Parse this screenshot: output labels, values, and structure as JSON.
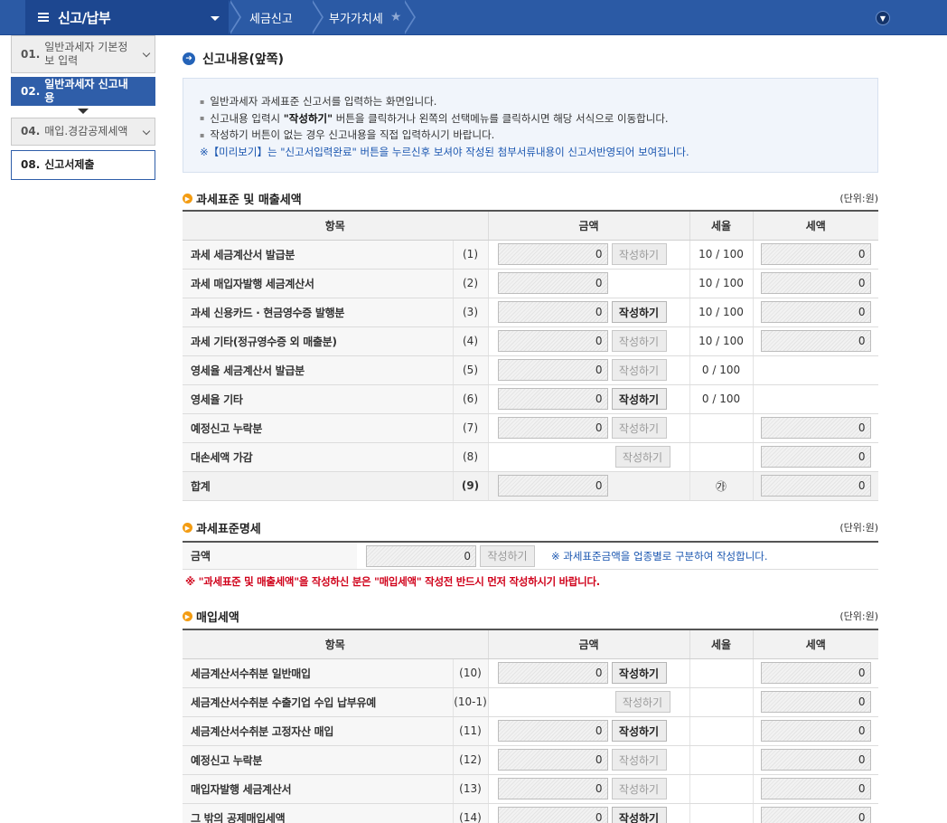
{
  "topbar": {
    "menu_title": "신고/납부",
    "breadcrumbs": [
      "세금신고",
      "부가가치세"
    ]
  },
  "left_nav": [
    {
      "num": "01.",
      "label": "일반과세자 기본정보 입력",
      "state": "default",
      "has_chevron": true
    },
    {
      "num": "02.",
      "label": "일반과세자 신고내용",
      "state": "active",
      "has_chevron": false
    },
    {
      "num": "04.",
      "label": "매입.경감공제세액",
      "state": "default",
      "has_chevron": true
    },
    {
      "num": "08.",
      "label": "신고서제출",
      "state": "plain",
      "has_chevron": false
    }
  ],
  "page_title": "신고내용(앞쪽)",
  "info": {
    "line1": "일반과세자 과세표준 신고서를 입력하는 화면입니다.",
    "line2_pre": "신고내용 입력시 ",
    "line2_bold": "\"작성하기\"",
    "line2_post": " 버튼을 클릭하거나 왼쪽의 선택메뉴를 클릭하시면 해당 서식으로 이동합니다.",
    "line3": "작성하기 버튼이 없는 경우 신고내용을 직접 입력하시기 바랍니다.",
    "note": "※【미리보기】는 \"신고서입력완료\" 버튼을 누르신후 보셔야 작성된 첨부서류내용이 신고서반영되어 보여집니다."
  },
  "unit": "(단위:원)",
  "columns": {
    "item": "항목",
    "amount": "금액",
    "rate": "세율",
    "tax": "세액"
  },
  "write_label": "작성하기",
  "section1": {
    "title": "과세표준 및 매출세액",
    "rows": [
      {
        "label": "과세 세금계산서 발급분",
        "code": "(1)",
        "amount": "0",
        "btn": "disabled",
        "rate": "10 / 100",
        "tax": "0"
      },
      {
        "label": "과세 매입자발행 세금계산서",
        "code": "(2)",
        "amount": "0",
        "btn": "none",
        "rate": "10 / 100",
        "tax": "0"
      },
      {
        "label": "과세 신용카드 · 현금영수증 발행분",
        "code": "(3)",
        "amount": "0",
        "btn": "on",
        "rate": "10 / 100",
        "tax": "0"
      },
      {
        "label": "과세 기타(정규영수증 외 매출분)",
        "code": "(4)",
        "amount": "0",
        "btn": "disabled",
        "rate": "10 / 100",
        "tax": "0"
      },
      {
        "label": "영세율 세금계산서 발급분",
        "code": "(5)",
        "amount": "0",
        "btn": "disabled",
        "rate": "0 / 100",
        "tax": null
      },
      {
        "label": "영세율 기타",
        "code": "(6)",
        "amount": "0",
        "btn": "on",
        "rate": "0 / 100",
        "tax": null
      },
      {
        "label": "예정신고 누락분",
        "code": "(7)",
        "amount": "0",
        "btn": "disabled",
        "rate": "",
        "tax": "0"
      },
      {
        "label": "대손세액 가감",
        "code": "(8)",
        "amount": null,
        "btn": "disabled",
        "rate": "",
        "tax": "0"
      },
      {
        "label": "합계",
        "code": "(9)",
        "amount": "0",
        "btn": "none",
        "rate": "㉮",
        "tax": "0",
        "sum": true
      }
    ]
  },
  "section2": {
    "title": "과세표준명세",
    "label": "금액",
    "amount": "0",
    "note": "※ 과세표준금액을 업종별로 구분하여 작성합니다."
  },
  "warning": "※ \"과세표준 및 매출세액\"을 작성하신 분은 \"매입세액\" 작성전 반드시 먼저 작성하시기 바랍니다.",
  "section3": {
    "title": "매입세액",
    "rows": [
      {
        "label": "세금계산서수취분 일반매입",
        "code": "(10)",
        "amount": "0",
        "btn": "on",
        "rate": "",
        "tax": "0"
      },
      {
        "label": "세금계산서수취분 수출기업 수입 납부유예",
        "code": "(10-1)",
        "amount": null,
        "btn": "disabled",
        "rate": "",
        "tax": "0"
      },
      {
        "label": "세금계산서수취분 고정자산 매입",
        "code": "(11)",
        "amount": "0",
        "btn": "on",
        "rate": "",
        "tax": "0"
      },
      {
        "label": "예정신고 누락분",
        "code": "(12)",
        "amount": "0",
        "btn": "disabled",
        "rate": "",
        "tax": "0"
      },
      {
        "label": "매입자발행 세금계산서",
        "code": "(13)",
        "amount": "0",
        "btn": "disabled",
        "rate": "",
        "tax": "0"
      },
      {
        "label": "그 밖의 공제매입세액",
        "code": "(14)",
        "amount": "0",
        "btn": "on",
        "rate": "",
        "tax": "0"
      }
    ]
  }
}
